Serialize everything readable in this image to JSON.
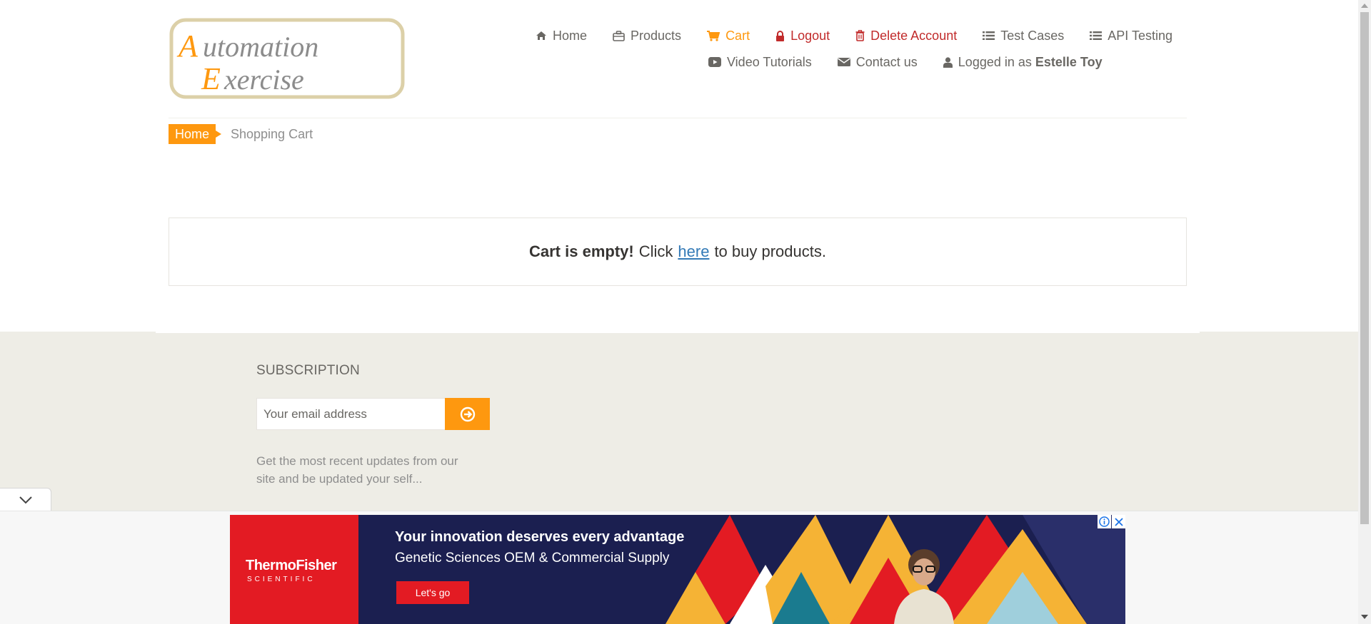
{
  "brand": {
    "logo_line1": "Automation",
    "logo_line2": "Exercise"
  },
  "nav": {
    "home": "Home",
    "products": "Products",
    "cart": "Cart",
    "logout": "Logout",
    "delete_account": "Delete Account",
    "test_cases": "Test Cases",
    "api_testing": "API Testing",
    "video_tutorials": "Video Tutorials",
    "contact_us": "Contact us",
    "logged_in_prefix": "Logged in as",
    "logged_in_user": "Estelle Toy"
  },
  "breadcrumb": {
    "home": "Home",
    "current": "Shopping Cart"
  },
  "cart": {
    "empty_bold": "Cart is empty!",
    "click": "Click",
    "link": "here",
    "suffix": "to buy products."
  },
  "footer": {
    "subscription_title": "SUBSCRIPTION",
    "email_placeholder": "Your email address",
    "description": "Get the most recent updates from our site and be updated your self..."
  },
  "ad": {
    "brand_line1": "ThermoFisher",
    "brand_line2": "SCIENTIFIC",
    "headline": "Your innovation deserves every advantage",
    "subline": "Genetic Sciences OEM & Commercial Supply",
    "cta": "Let's go"
  },
  "colors": {
    "accent": "#fe980f",
    "danger": "#c12b2b",
    "link": "#337ab7",
    "footer_bg": "#eeede6",
    "ad_bg": "#1b1f50",
    "ad_red": "#e31b23"
  }
}
